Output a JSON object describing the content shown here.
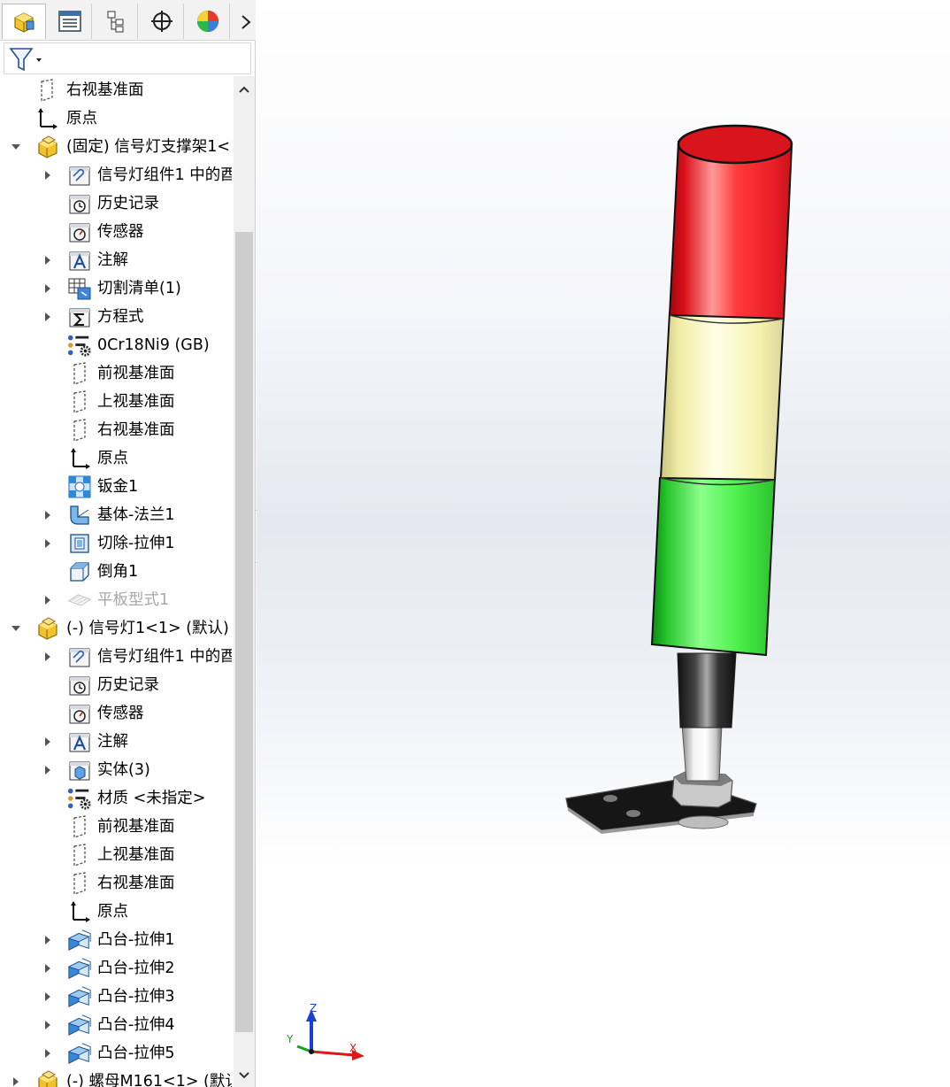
{
  "tabs": [
    {
      "name": "feature-manager",
      "icon": "assembly-icon"
    },
    {
      "name": "property-manager",
      "icon": "property-list-icon"
    },
    {
      "name": "configuration-manager",
      "icon": "configuration-tree-icon"
    },
    {
      "name": "dimxpert-manager",
      "icon": "crosshair-icon"
    },
    {
      "name": "display-manager",
      "icon": "appearance-sphere-icon"
    }
  ],
  "tree": [
    {
      "label": "右视基准面",
      "icon": "plane",
      "indent": 0,
      "expander": "none"
    },
    {
      "label": "原点",
      "icon": "origin",
      "indent": 0,
      "expander": "none"
    },
    {
      "label": "(固定) 信号灯支撑架1<1",
      "icon": "part",
      "indent": -1,
      "expander": "expanded"
    },
    {
      "label": "信号灯组件1 中的酉",
      "icon": "folder-clip",
      "indent": 1,
      "expander": "collapsed"
    },
    {
      "label": "历史记录",
      "icon": "history",
      "indent": 1,
      "expander": "none"
    },
    {
      "label": "传感器",
      "icon": "sensor",
      "indent": 1,
      "expander": "none"
    },
    {
      "label": "注解",
      "icon": "annotation",
      "indent": 1,
      "expander": "collapsed"
    },
    {
      "label": "切割清单(1)",
      "icon": "cutlist",
      "indent": 1,
      "expander": "collapsed"
    },
    {
      "label": "方程式",
      "icon": "equation",
      "indent": 1,
      "expander": "collapsed"
    },
    {
      "label": "0Cr18Ni9 (GB)",
      "icon": "material",
      "indent": 1,
      "expander": "none"
    },
    {
      "label": "前视基准面",
      "icon": "plane",
      "indent": 1,
      "expander": "none"
    },
    {
      "label": "上视基准面",
      "icon": "plane",
      "indent": 1,
      "expander": "none"
    },
    {
      "label": "右视基准面",
      "icon": "plane",
      "indent": 1,
      "expander": "none"
    },
    {
      "label": "原点",
      "icon": "origin",
      "indent": 1,
      "expander": "none"
    },
    {
      "label": "钣金1",
      "icon": "sheetmetal",
      "indent": 1,
      "expander": "none"
    },
    {
      "label": "基体-法兰1",
      "icon": "baseflange",
      "indent": 1,
      "expander": "collapsed"
    },
    {
      "label": "切除-拉伸1",
      "icon": "cutextrude",
      "indent": 1,
      "expander": "collapsed"
    },
    {
      "label": "倒角1",
      "icon": "chamfer",
      "indent": 1,
      "expander": "none"
    },
    {
      "label": "平板型式1",
      "icon": "flatpattern",
      "indent": 1,
      "expander": "collapsed",
      "dim": true
    },
    {
      "label": "(-) 信号灯1<1> (默认) <",
      "icon": "part",
      "indent": -1,
      "expander": "expanded"
    },
    {
      "label": "信号灯组件1 中的酉",
      "icon": "folder-clip",
      "indent": 1,
      "expander": "collapsed"
    },
    {
      "label": "历史记录",
      "icon": "history",
      "indent": 1,
      "expander": "none"
    },
    {
      "label": "传感器",
      "icon": "sensor",
      "indent": 1,
      "expander": "none"
    },
    {
      "label": "注解",
      "icon": "annotation",
      "indent": 1,
      "expander": "collapsed"
    },
    {
      "label": "实体(3)",
      "icon": "solidbody",
      "indent": 1,
      "expander": "collapsed"
    },
    {
      "label": "材质 <未指定>",
      "icon": "material",
      "indent": 1,
      "expander": "none"
    },
    {
      "label": "前视基准面",
      "icon": "plane",
      "indent": 1,
      "expander": "none"
    },
    {
      "label": "上视基准面",
      "icon": "plane",
      "indent": 1,
      "expander": "none"
    },
    {
      "label": "右视基准面",
      "icon": "plane",
      "indent": 1,
      "expander": "none"
    },
    {
      "label": "原点",
      "icon": "origin",
      "indent": 1,
      "expander": "none"
    },
    {
      "label": "凸台-拉伸1",
      "icon": "bossextrude",
      "indent": 1,
      "expander": "collapsed"
    },
    {
      "label": "凸台-拉伸2",
      "icon": "bossextrude",
      "indent": 1,
      "expander": "collapsed"
    },
    {
      "label": "凸台-拉伸3",
      "icon": "bossextrude",
      "indent": 1,
      "expander": "collapsed"
    },
    {
      "label": "凸台-拉伸4",
      "icon": "bossextrude",
      "indent": 1,
      "expander": "collapsed"
    },
    {
      "label": "凸台-拉伸5",
      "icon": "bossextrude",
      "indent": 1,
      "expander": "collapsed"
    },
    {
      "label": "(-) 螺母M161<1> (默认",
      "icon": "part",
      "indent": -1,
      "expander": "collapsed"
    }
  ],
  "triad": {
    "x": "X",
    "y": "Y",
    "z": "Z"
  },
  "colors": {
    "red": "#e8202a",
    "yellow": "#f6f3b0",
    "green": "#3fdc3f",
    "plate": "#1a1a1a"
  }
}
